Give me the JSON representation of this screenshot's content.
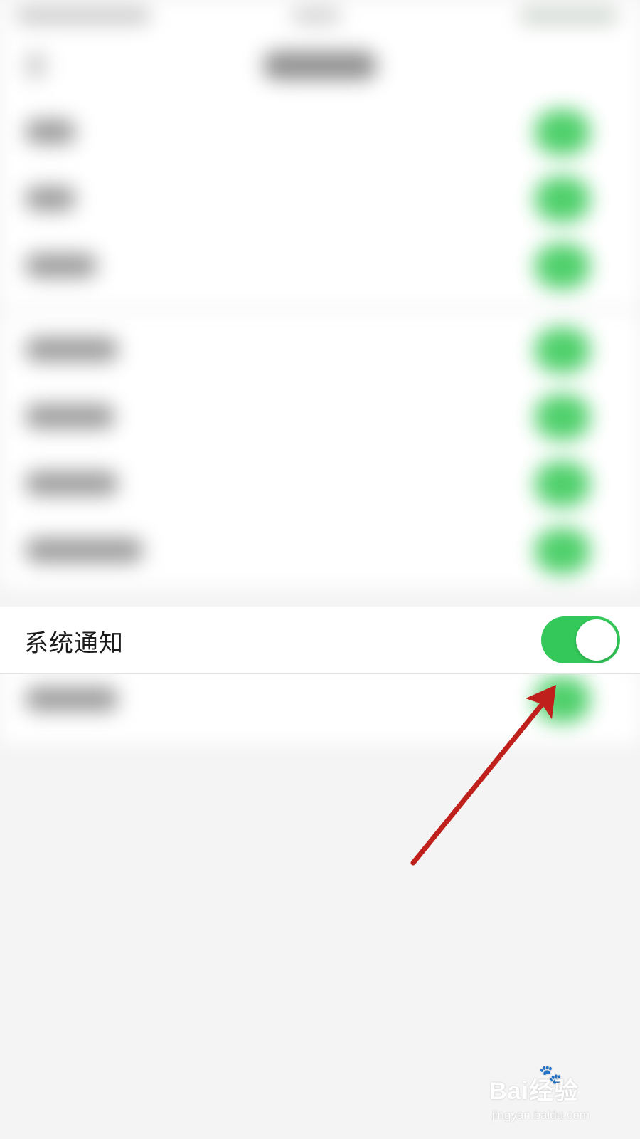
{
  "settings": {
    "system_notification": {
      "label": "系统通知",
      "enabled": true
    }
  },
  "colors": {
    "toggle_on": "#34c759",
    "annotation_arrow": "#c0201b",
    "background": "#f4f4f4"
  },
  "annotation": {
    "icon": "red-arrow-icon",
    "points_to": "system-notification-toggle"
  },
  "watermark": {
    "logo": "Bai经验",
    "url": "jingyan.baidu.com"
  }
}
